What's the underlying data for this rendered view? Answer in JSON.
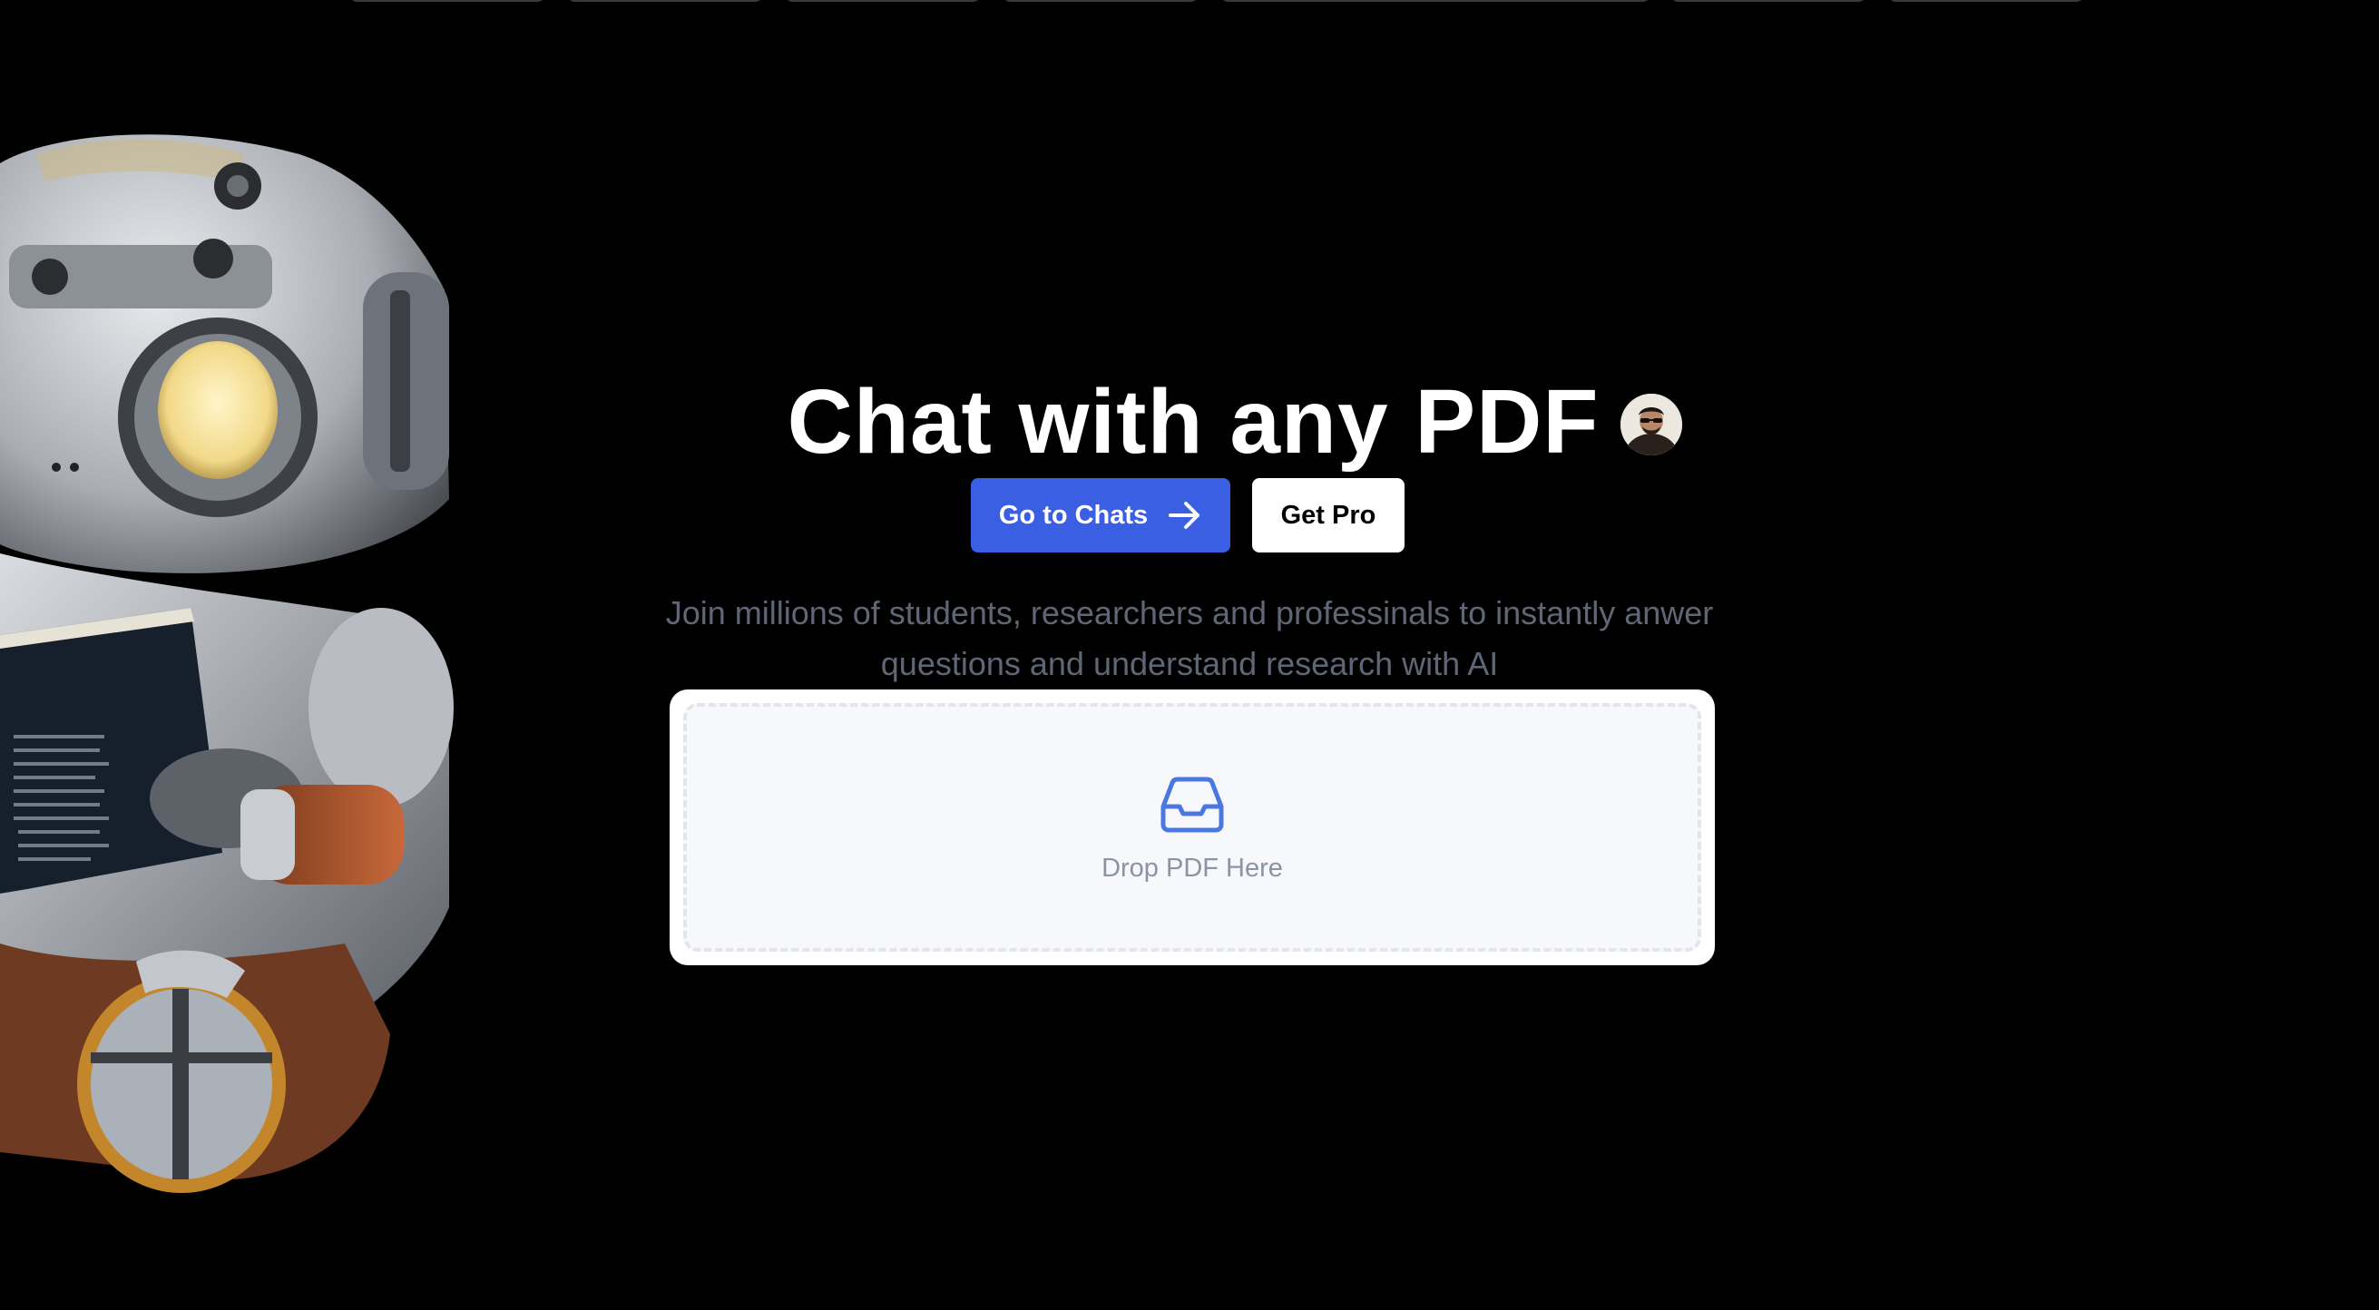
{
  "hero": {
    "title": "Chat with any PDF",
    "avatar_icon": "user-avatar",
    "subtitle": "Join millions of students, researchers and professinals to instantly anwer questions and understand research with AI"
  },
  "actions": {
    "primary_label": "Go to Chats",
    "primary_icon": "arrow-right-icon",
    "secondary_label": "Get Pro"
  },
  "upload": {
    "icon": "inbox-icon",
    "label": "Drop PDF Here"
  },
  "colors": {
    "background": "#000000",
    "primary": "#3b5fe2",
    "icon_accent": "#4a78e0",
    "subtitle": "#5f6675",
    "dropzone_label": "#8b94a3"
  }
}
